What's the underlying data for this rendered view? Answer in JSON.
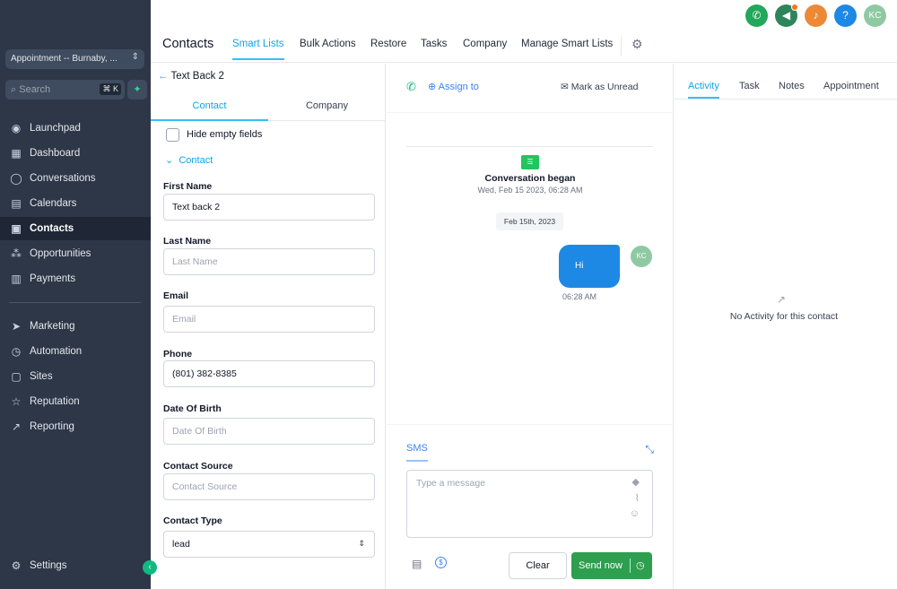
{
  "sidebar": {
    "location": "Appointment -- Burnaby, ...",
    "search_placeholder": "Search",
    "search_shortcut": "⌘ K",
    "items": [
      {
        "label": "Launchpad",
        "icon": "rocket-icon"
      },
      {
        "label": "Dashboard",
        "icon": "grid-icon"
      },
      {
        "label": "Conversations",
        "icon": "chat-icon"
      },
      {
        "label": "Calendars",
        "icon": "calendar-icon"
      },
      {
        "label": "Contacts",
        "icon": "contacts-icon"
      },
      {
        "label": "Opportunities",
        "icon": "opportunities-icon"
      },
      {
        "label": "Payments",
        "icon": "payments-icon"
      }
    ],
    "items2": [
      {
        "label": "Marketing",
        "icon": "send-icon"
      },
      {
        "label": "Automation",
        "icon": "automation-icon"
      },
      {
        "label": "Sites",
        "icon": "sites-icon"
      },
      {
        "label": "Reputation",
        "icon": "star-icon"
      },
      {
        "label": "Reporting",
        "icon": "trend-icon"
      }
    ],
    "settings": "Settings",
    "active_color": "#1f2736"
  },
  "topbar": {
    "avatar_initials": "KC",
    "buttons": [
      {
        "icon": "phone-icon",
        "color": "#22a75b"
      },
      {
        "icon": "megaphone-icon",
        "color": "#2f855a"
      },
      {
        "icon": "bell-icon",
        "color": "#ed8936"
      },
      {
        "icon": "help-icon",
        "color": "#1e88e5",
        "glyph": "?"
      },
      {
        "icon": "avatar",
        "color": "#8fc9a3"
      }
    ]
  },
  "header": {
    "title": "Contacts",
    "tabs": [
      "Smart Lists",
      "Bulk Actions",
      "Restore",
      "Tasks",
      "Company",
      "Manage Smart Lists"
    ]
  },
  "contact": {
    "back_label": "Text Back 2",
    "tabs": [
      "Contact",
      "Company"
    ],
    "hide_empty": "Hide empty fields",
    "section": "Contact",
    "fields": [
      {
        "label": "First Name",
        "value": "Text back 2",
        "placeholder": ""
      },
      {
        "label": "Last Name",
        "value": "",
        "placeholder": "Last Name"
      },
      {
        "label": "Email",
        "value": "",
        "placeholder": "Email"
      },
      {
        "label": "Phone",
        "value": "(801) 382-8385",
        "placeholder": ""
      },
      {
        "label": "Date Of Birth",
        "value": "",
        "placeholder": "Date Of Birth"
      },
      {
        "label": "Contact Source",
        "value": "",
        "placeholder": "Contact Source"
      },
      {
        "label": "Contact Type",
        "value": "lead",
        "placeholder": ""
      }
    ]
  },
  "conversation": {
    "assign": "Assign to",
    "mark_unread": "Mark as Unread",
    "began": "Conversation began",
    "began_date": "Wed, Feb 15 2023, 06:28 AM",
    "date_chip": "Feb 15th, 2023",
    "message": "Hi",
    "message_time": "06:28 AM",
    "avatar": "KC",
    "channel": "SMS",
    "input_placeholder": "Type a message",
    "clear": "Clear",
    "send": "Send now",
    "accent": "#1e88e5",
    "send_color": "#2e9e4f"
  },
  "activity": {
    "tabs": [
      "Activity",
      "Task",
      "Notes",
      "Appointment"
    ],
    "empty": "No Activity for this contact"
  }
}
